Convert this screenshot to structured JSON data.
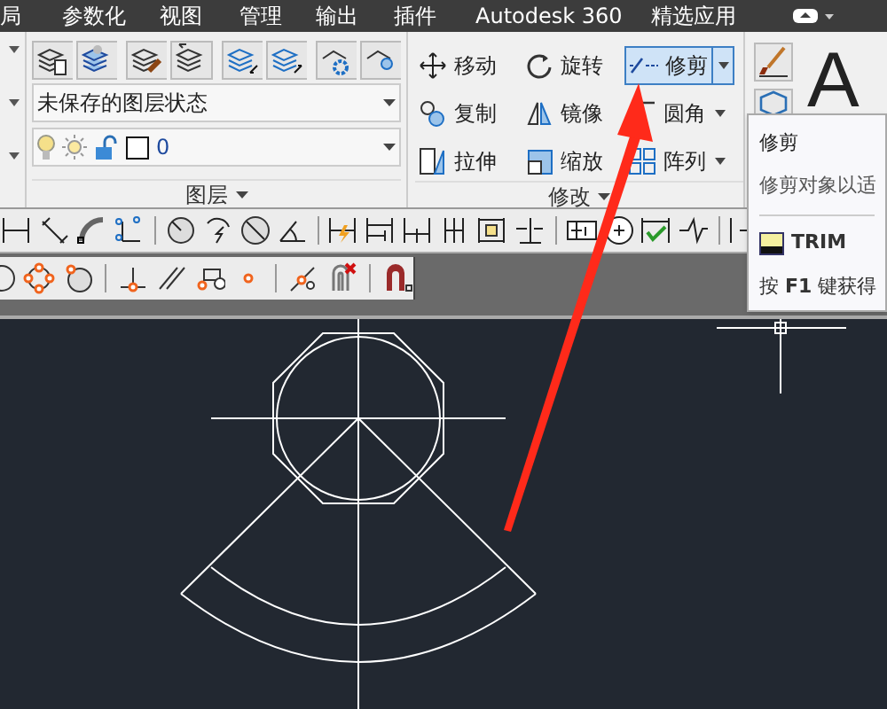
{
  "menu": [
    {
      "label": "局"
    },
    {
      "label": "参数化"
    },
    {
      "label": "视图"
    },
    {
      "label": "管理"
    },
    {
      "label": "输出"
    },
    {
      "label": "插件"
    },
    {
      "label": "Autodesk 360"
    },
    {
      "label": "精选应用"
    }
  ],
  "layer_panel": {
    "layer_state": "未保存的图层状态",
    "current_layer": "0",
    "title": "图层"
  },
  "modify_panel": {
    "title": "修改",
    "tools": [
      {
        "label": "移动",
        "selected": false,
        "dropdown": false
      },
      {
        "label": "旋转",
        "selected": false,
        "dropdown": false
      },
      {
        "label": "修剪",
        "selected": true,
        "dropdown": true
      },
      {
        "label": "复制",
        "selected": false,
        "dropdown": false
      },
      {
        "label": "镜像",
        "selected": false,
        "dropdown": false
      },
      {
        "label": "圆角",
        "selected": false,
        "dropdown": true
      },
      {
        "label": "拉伸",
        "selected": false,
        "dropdown": false
      },
      {
        "label": "缩放",
        "selected": false,
        "dropdown": false
      },
      {
        "label": "阵列",
        "selected": false,
        "dropdown": true
      }
    ]
  },
  "text_tool": "A",
  "tooltip": {
    "title": "修剪",
    "description": "修剪对象以适",
    "command": "TRIM",
    "help": "按 **F1** 键获得"
  }
}
